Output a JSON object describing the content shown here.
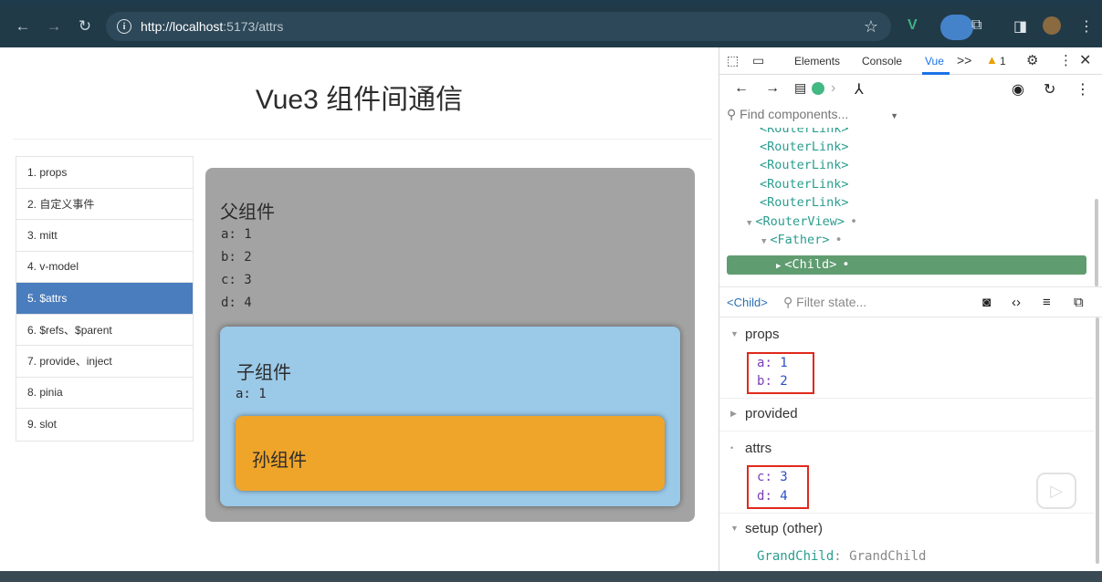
{
  "browser": {
    "url_host": "http://localhost",
    "url_rest": ":5173/attrs",
    "back_icon": "arrow-left-icon",
    "forward_icon": "arrow-right-icon",
    "reload_icon": "reload-icon"
  },
  "page": {
    "title": "Vue3 组件间通信",
    "nav_items": [
      "1. props",
      "2. 自定义事件",
      "3. mitt",
      "4. v-model",
      "5. $attrs",
      "6. $refs、$parent",
      "7. provide、inject",
      "8. pinia",
      "9. slot"
    ],
    "active_index": 4,
    "father": {
      "title": "父组件",
      "values": [
        "a: 1",
        "b: 2",
        "c: 3",
        "d: 4"
      ]
    },
    "child": {
      "title": "子组件",
      "values": [
        "a: 1"
      ]
    },
    "grandchild": {
      "title": "孙组件"
    }
  },
  "devtools": {
    "tabs": [
      "Elements",
      "Console",
      "Vue"
    ],
    "more_tabs": ">>",
    "warning_count": "1",
    "find_placeholder": "Find components...",
    "tree": [
      {
        "label": "<RouterLink>",
        "depth": 0
      },
      {
        "label": "<RouterLink>",
        "depth": 0
      },
      {
        "label": "<RouterLink>",
        "depth": 0
      },
      {
        "label": "<RouterLink>",
        "depth": 0
      },
      {
        "label": "<RouterLink>",
        "depth": 0
      },
      {
        "label": "<RouterView>",
        "depth": 0
      },
      {
        "label": "<Father>",
        "depth": 1
      },
      {
        "label": "<Child>",
        "depth": 2
      }
    ],
    "selected_component": "<Child>",
    "filter_placeholder": "Filter state...",
    "sections": {
      "props": "props",
      "provided": "provided",
      "attrs": "attrs",
      "setup": "setup (other)"
    },
    "props": [
      {
        "key": "a",
        "value": "1"
      },
      {
        "key": "b",
        "value": "2"
      }
    ],
    "attrs": [
      {
        "key": "c",
        "value": "3"
      },
      {
        "key": "d",
        "value": "4"
      }
    ],
    "setup": [
      {
        "key": "GrandChild",
        "value": "GrandChild"
      }
    ]
  }
}
